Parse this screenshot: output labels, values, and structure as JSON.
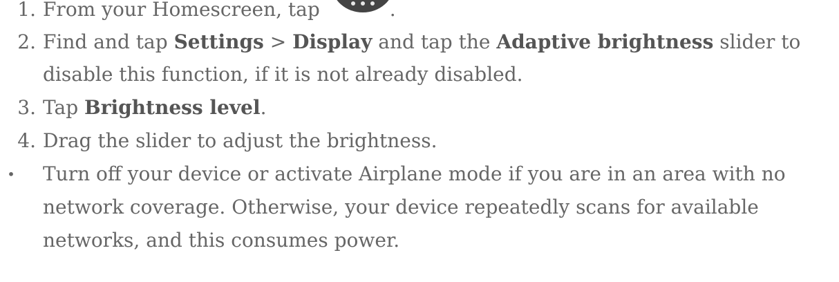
{
  "steps": [
    {
      "number": "1.",
      "before_icon": "From your Homescreen, tap",
      "icon": "apps-grid-icon",
      "after_icon": "."
    },
    {
      "number": "2.",
      "t1": "Find and tap ",
      "b1": "Settings",
      "t2": " > ",
      "b2": "Display",
      "t3": " and tap the ",
      "b3": "Adaptive brightness",
      "t4": " slider to",
      "line2": "disable this function, if it is not already disabled."
    },
    {
      "number": "3.",
      "t1": "Tap ",
      "b1": "Brightness level",
      "t2": "."
    },
    {
      "number": "4.",
      "t1": "Drag the slider to adjust the brightness."
    }
  ],
  "tip": {
    "bullet": "•",
    "line1": "Turn off your device or activate Airplane mode if you are in an area with no",
    "line2": "network coverage. Otherwise, your device repeatedly scans for available",
    "line3": "networks, and this consumes power."
  },
  "colors": {
    "text": "#666666",
    "bold_text": "#555555",
    "icon_disc": "#444444",
    "icon_dots": "#e6e6e6"
  }
}
